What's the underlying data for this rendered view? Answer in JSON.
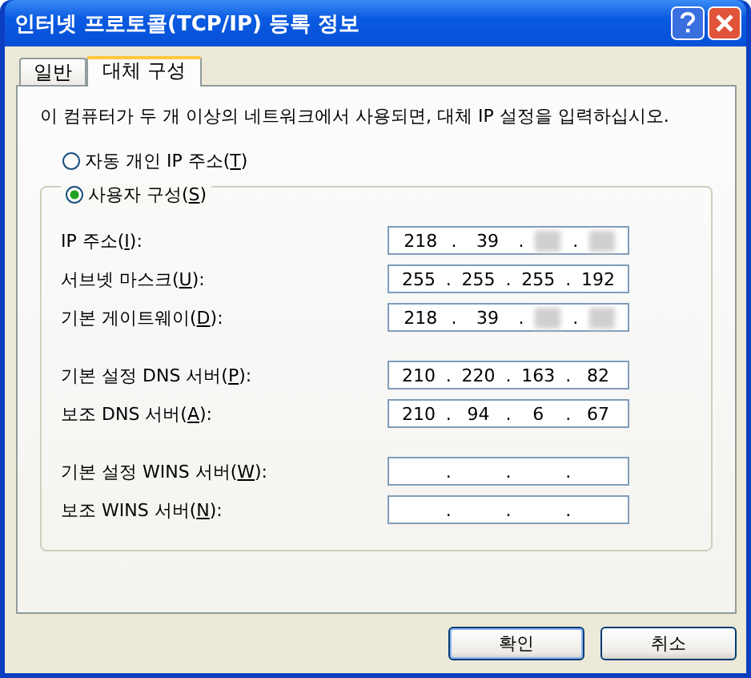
{
  "window": {
    "title": "인터넷 프로토콜(TCP/IP) 등록 정보"
  },
  "tabs": [
    {
      "label": "일반",
      "selected": false
    },
    {
      "label": "대체 구성",
      "selected": true
    }
  ],
  "description": "이 컴퓨터가 두 개 이상의 네트워크에서 사용되면, 대체 IP 설정을 입력하십시오.",
  "options": [
    {
      "label": "자동 개인 IP 주소(",
      "access_key": "T",
      "label_end": ")",
      "selected": false
    },
    {
      "label": "사용자 구성(",
      "access_key": "S",
      "label_end": ")",
      "selected": true
    }
  ],
  "octet_separator": ".",
  "field_groups": [
    {
      "fields": [
        {
          "label": "IP 주소(",
          "access_key": "I",
          "label_end": "):",
          "octets": [
            {
              "value": "218"
            },
            {
              "value": "39"
            },
            {
              "masked": true
            },
            {
              "masked": true
            }
          ]
        },
        {
          "label": "서브넷 마스크(",
          "access_key": "U",
          "label_end": "):",
          "octets": [
            {
              "value": "255"
            },
            {
              "value": "255"
            },
            {
              "value": "255"
            },
            {
              "value": "192"
            }
          ]
        },
        {
          "label": "기본 게이트웨이(",
          "access_key": "D",
          "label_end": "):",
          "octets": [
            {
              "value": "218"
            },
            {
              "value": "39"
            },
            {
              "masked": true
            },
            {
              "masked": true
            }
          ]
        }
      ]
    },
    {
      "fields": [
        {
          "label": "기본 설정 DNS 서버(",
          "access_key": "P",
          "label_end": "):",
          "octets": [
            {
              "value": "210"
            },
            {
              "value": "220"
            },
            {
              "value": "163"
            },
            {
              "value": "82"
            }
          ]
        },
        {
          "label": "보조 DNS 서버(",
          "access_key": "A",
          "label_end": "):",
          "octets": [
            {
              "value": "210"
            },
            {
              "value": "94"
            },
            {
              "value": "6"
            },
            {
              "value": "67"
            }
          ]
        }
      ]
    },
    {
      "fields": [
        {
          "label": "기본 설정 WINS 서버(",
          "access_key": "W",
          "label_end": "):"
        },
        {
          "label": "보조 WINS 서버(",
          "access_key": "N",
          "label_end": "):"
        }
      ]
    }
  ],
  "buttons": [
    {
      "label": "확인",
      "default": true
    },
    {
      "label": "취소",
      "default": false
    }
  ]
}
